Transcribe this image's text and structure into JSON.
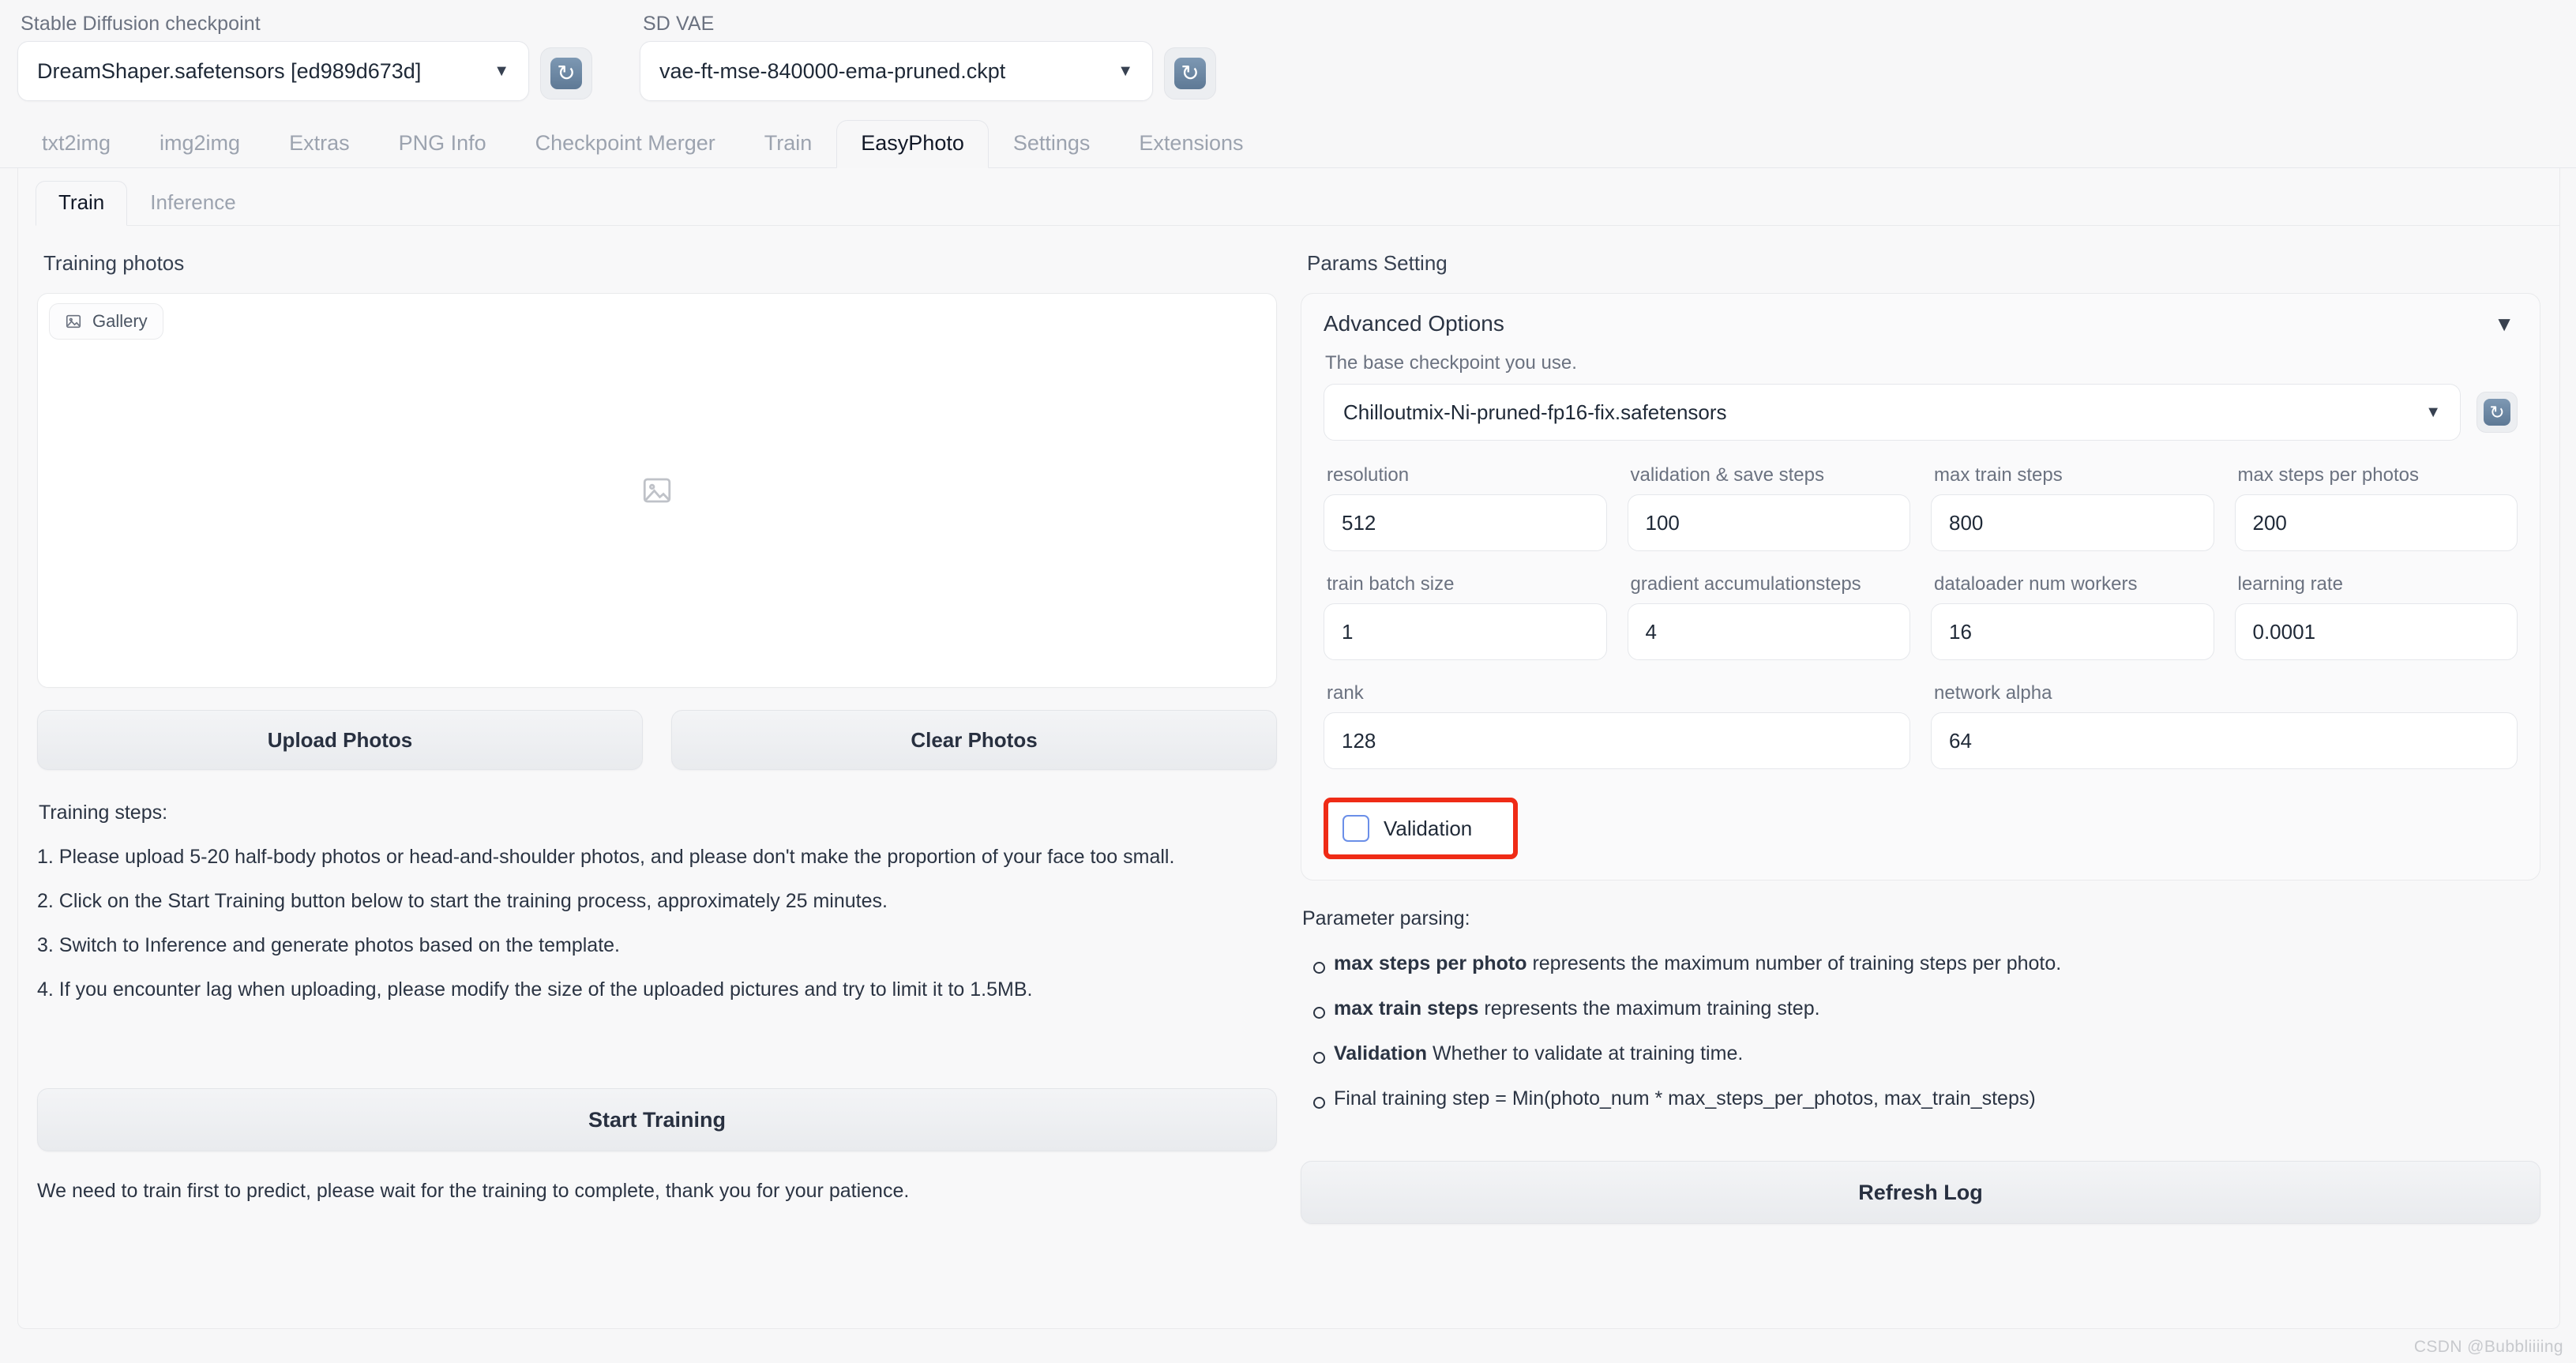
{
  "topbar": {
    "checkpoint": {
      "label": "Stable Diffusion checkpoint",
      "value": "DreamShaper.safetensors [ed989d673d]",
      "caret": "▼",
      "refresh_icon": "refresh-icon"
    },
    "vae": {
      "label": "SD VAE",
      "value": "vae-ft-mse-840000-ema-pruned.ckpt",
      "caret": "▼",
      "refresh_icon": "refresh-icon"
    }
  },
  "main_tabs": [
    {
      "label": "txt2img",
      "active": false
    },
    {
      "label": "img2img",
      "active": false
    },
    {
      "label": "Extras",
      "active": false
    },
    {
      "label": "PNG Info",
      "active": false
    },
    {
      "label": "Checkpoint Merger",
      "active": false
    },
    {
      "label": "Train",
      "active": false
    },
    {
      "label": "EasyPhoto",
      "active": true
    },
    {
      "label": "Settings",
      "active": false
    },
    {
      "label": "Extensions",
      "active": false
    }
  ],
  "sub_tabs": [
    {
      "label": "Train",
      "active": true
    },
    {
      "label": "Inference",
      "active": false
    }
  ],
  "left": {
    "section_title": "Training photos",
    "gallery": {
      "chip_label": "Gallery",
      "chip_icon": "image-icon",
      "placeholder_icon": "image-placeholder-icon"
    },
    "upload_button": "Upload Photos",
    "clear_button": "Clear Photos",
    "steps_heading": "Training steps:",
    "steps": [
      "1. Please upload 5-20 half-body photos or head-and-shoulder photos, and please don't make the proportion of your face too small.",
      "2. Click on the Start Training button below to start the training process, approximately 25 minutes.",
      "3. Switch to Inference and generate photos based on the template.",
      "4. If you encounter lag when uploading, please modify the size of the uploaded pictures and try to limit it to 1.5MB."
    ],
    "start_training_button": "Start Training",
    "status_note": "We need to train first to predict, please wait for the training to complete, thank you for your patience."
  },
  "right": {
    "section_title": "Params Setting",
    "advanced": {
      "title": "Advanced Options",
      "collapse_arrow": "▼",
      "base_ckpt_label": "The base checkpoint you use.",
      "base_ckpt_value": "Chilloutmix-Ni-pruned-fp16-fix.safetensors",
      "caret": "▼",
      "refresh_icon": "refresh-icon",
      "fields_row1": [
        {
          "label": "resolution",
          "value": "512"
        },
        {
          "label": "validation & save steps",
          "value": "100"
        },
        {
          "label": "max train steps",
          "value": "800"
        },
        {
          "label": "max steps per photos",
          "value": "200"
        }
      ],
      "fields_row2": [
        {
          "label": "train batch size",
          "value": "1"
        },
        {
          "label": "gradient accumulationsteps",
          "value": "4"
        },
        {
          "label": "dataloader num workers",
          "value": "16"
        },
        {
          "label": "learning rate",
          "value": "0.0001"
        }
      ],
      "fields_row3": [
        {
          "label": "rank",
          "value": "128"
        },
        {
          "label": "network alpha",
          "value": "64"
        }
      ],
      "validation": {
        "label": "Validation",
        "checked": false,
        "highlight_color": "#ef2b16"
      }
    },
    "parameter_parsing_heading": "Parameter parsing:",
    "parameter_parsing": [
      {
        "bold": "max steps per photo",
        "rest": " represents the maximum number of training steps per photo."
      },
      {
        "bold": "max train steps",
        "rest": " represents the maximum training step."
      },
      {
        "bold": "Validation",
        "rest": " Whether to validate at training time."
      },
      {
        "bold": "",
        "rest": "Final training step = Min(photo_num * max_steps_per_photos, max_train_steps)"
      }
    ],
    "refresh_log_button": "Refresh Log"
  },
  "watermark": "CSDN @Bubbliiiing"
}
